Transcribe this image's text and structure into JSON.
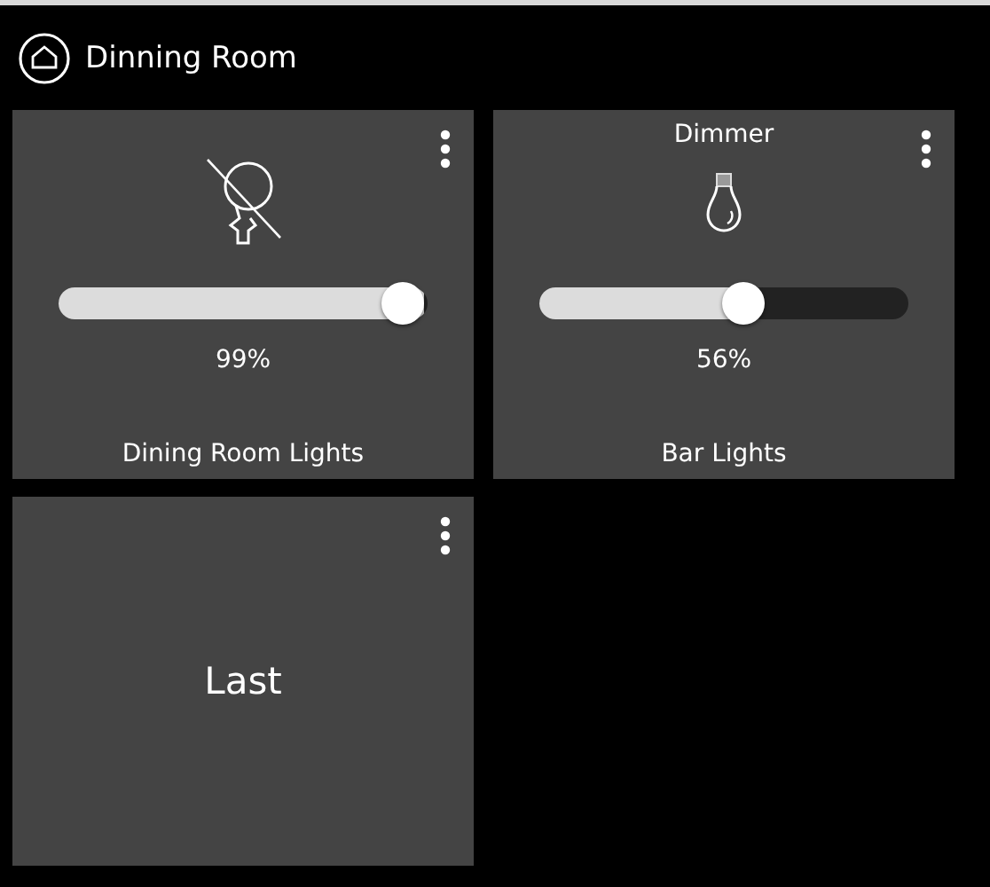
{
  "header": {
    "title": "Dinning Room"
  },
  "tiles": [
    {
      "kind": "dimmer",
      "name": "Dining Room Lights",
      "on": false,
      "level": 0.99,
      "reading": "99%"
    },
    {
      "kind": "dimmer",
      "title": "Dimmer",
      "name": "Bar Lights",
      "on": true,
      "level": 0.56,
      "reading": "56%"
    },
    {
      "kind": "label",
      "name": "Last"
    }
  ]
}
